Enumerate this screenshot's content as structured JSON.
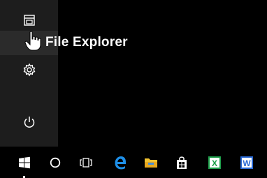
{
  "start_menu": {
    "rail": [
      {
        "name": "file-explorer",
        "icon": "file-explorer-icon"
      },
      {
        "name": "settings",
        "icon": "gear-icon"
      },
      {
        "name": "power",
        "icon": "power-icon"
      }
    ],
    "hover_label": "File Explorer"
  },
  "taskbar": {
    "items": [
      {
        "name": "start",
        "icon": "windows-logo-icon"
      },
      {
        "name": "search",
        "icon": "cortana-circle-icon"
      },
      {
        "name": "task-view",
        "icon": "task-view-icon"
      },
      {
        "name": "edge",
        "icon": "edge-icon"
      },
      {
        "name": "file-explorer",
        "icon": "folder-icon"
      },
      {
        "name": "store",
        "icon": "store-bag-icon"
      },
      {
        "name": "excel",
        "icon": "excel-icon",
        "letter": "X"
      },
      {
        "name": "word",
        "icon": "word-icon",
        "letter": "W"
      }
    ]
  },
  "colors": {
    "background": "#000000",
    "rail": "#1d1d1d",
    "edge_blue": "#1e8fe8",
    "folder_yellow": "#f2c230",
    "excel_green": "#1e9e4a",
    "word_blue": "#2b6bd6"
  }
}
